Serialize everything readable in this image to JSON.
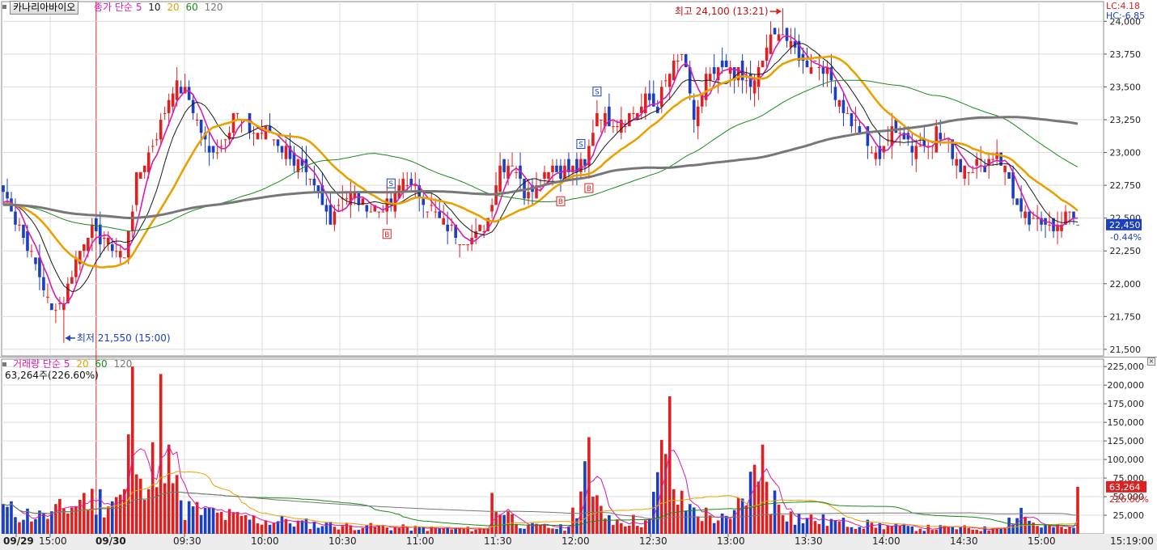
{
  "stock_name": "카나리아바이오",
  "price_legend": {
    "label": "종가 단순",
    "periods": [
      "5",
      "10",
      "20",
      "60",
      "120"
    ]
  },
  "volume_legend": {
    "label": "거래량 단순",
    "periods": [
      "5",
      "20",
      "60",
      "120"
    ]
  },
  "volume_info": "63,264주(226.60%)",
  "lc": "LC:4.18",
  "hc": "HC:-6.85",
  "current_price": "22,450",
  "current_change": "-0.44%",
  "current_volume": "63,264",
  "volume_ratio": "226.60%",
  "high_annotation": "최고 24,100 (13:21)",
  "low_annotation": "최저 21,550 (15:00)",
  "time_readout": "15:19:00",
  "colors": {
    "up": "#e02020",
    "down": "#1a3fc4",
    "ma5": "#d81bb0",
    "ma10": "#1a1a1a",
    "ma20": "#e8a200",
    "ma60": "#1a8a1a",
    "ma120": "#777777"
  },
  "chart_data": {
    "type": "candlestick",
    "price_axis": {
      "ticks": [
        21500,
        21750,
        22000,
        22250,
        22500,
        22750,
        23000,
        23250,
        23500,
        23750,
        24000
      ],
      "tick_labels": [
        "21,500",
        "21,750",
        "22,000",
        "22,250",
        "22,500",
        "22,750",
        "23,000",
        "23,250",
        "23,500",
        "23,750",
        "24,000"
      ],
      "range": [
        21450,
        24150
      ]
    },
    "volume_axis": {
      "ticks": [
        25000,
        50000,
        75000,
        100000,
        125000,
        150000,
        175000,
        200000,
        225000
      ],
      "tick_labels": [
        "25,000",
        "50,000",
        "75,000",
        "100,000",
        "125,000",
        "150,000",
        "175,000",
        "200,000",
        "225,000"
      ],
      "range": [
        0,
        235000
      ]
    },
    "time_axis": {
      "labels": [
        "09/29",
        "15:00",
        "09/30",
        "09:30",
        "10:00",
        "10:30",
        "11:00",
        "11:30",
        "12:00",
        "12:30",
        "13:00",
        "13:30",
        "14:00",
        "14:30",
        "15:00"
      ],
      "bold": [
        "09/29",
        "09/30"
      ]
    },
    "price_anchors": [
      [
        0,
        22720
      ],
      [
        3,
        22500
      ],
      [
        6,
        22300
      ],
      [
        9,
        22050
      ],
      [
        12,
        21800
      ],
      [
        15,
        21900
      ],
      [
        18,
        22200
      ],
      [
        21,
        22400
      ],
      [
        24,
        22350
      ],
      [
        27,
        22300
      ],
      [
        30,
        22200
      ],
      [
        33,
        22800
      ],
      [
        36,
        23000
      ],
      [
        39,
        23200
      ],
      [
        42,
        23500
      ],
      [
        45,
        23450
      ],
      [
        48,
        23250
      ],
      [
        51,
        23000
      ],
      [
        54,
        23050
      ],
      [
        57,
        23300
      ],
      [
        60,
        23200
      ],
      [
        63,
        23150
      ],
      [
        66,
        23150
      ],
      [
        69,
        23050
      ],
      [
        72,
        22950
      ],
      [
        75,
        22800
      ],
      [
        78,
        22650
      ],
      [
        81,
        22500
      ],
      [
        84,
        22700
      ],
      [
        87,
        22650
      ],
      [
        90,
        22600
      ],
      [
        93,
        22550
      ],
      [
        96,
        22620
      ],
      [
        99,
        22800
      ],
      [
        102,
        22700
      ],
      [
        105,
        22600
      ],
      [
        108,
        22500
      ],
      [
        111,
        22400
      ],
      [
        114,
        22350
      ],
      [
        117,
        22380
      ],
      [
        120,
        22500
      ],
      [
        123,
        22900
      ],
      [
        126,
        22950
      ],
      [
        129,
        22700
      ],
      [
        132,
        22750
      ],
      [
        135,
        22900
      ],
      [
        138,
        22850
      ],
      [
        141,
        22850
      ],
      [
        144,
        22900
      ],
      [
        147,
        23300
      ],
      [
        150,
        23250
      ],
      [
        153,
        23250
      ],
      [
        156,
        23300
      ],
      [
        159,
        23400
      ],
      [
        162,
        23350
      ],
      [
        165,
        23600
      ],
      [
        168,
        23750
      ],
      [
        171,
        23250
      ],
      [
        174,
        23550
      ],
      [
        177,
        23600
      ],
      [
        180,
        23650
      ],
      [
        183,
        23550
      ],
      [
        186,
        23500
      ],
      [
        189,
        23800
      ],
      [
        192,
        23950
      ],
      [
        195,
        23820
      ],
      [
        198,
        23700
      ],
      [
        201,
        23700
      ],
      [
        204,
        23600
      ],
      [
        207,
        23400
      ],
      [
        210,
        23250
      ],
      [
        213,
        23100
      ],
      [
        216,
        22950
      ],
      [
        219,
        23100
      ],
      [
        222,
        23200
      ],
      [
        225,
        23050
      ],
      [
        228,
        23050
      ],
      [
        231,
        23150
      ],
      [
        234,
        23050
      ],
      [
        237,
        22900
      ],
      [
        240,
        22900
      ],
      [
        243,
        22900
      ],
      [
        246,
        23000
      ],
      [
        249,
        22800
      ],
      [
        252,
        22500
      ],
      [
        255,
        22450
      ],
      [
        258,
        22500
      ],
      [
        261,
        22420
      ],
      [
        264,
        22550
      ],
      [
        266,
        22450
      ]
    ],
    "volume_anchors": [
      [
        0,
        40000
      ],
      [
        10,
        28000
      ],
      [
        20,
        55000
      ],
      [
        30,
        60000
      ],
      [
        32,
        225000
      ],
      [
        33,
        80000
      ],
      [
        36,
        60000
      ],
      [
        39,
        215000
      ],
      [
        41,
        120000
      ],
      [
        44,
        45000
      ],
      [
        50,
        35000
      ],
      [
        60,
        25000
      ],
      [
        70,
        20000
      ],
      [
        80,
        15000
      ],
      [
        90,
        12000
      ],
      [
        100,
        10000
      ],
      [
        110,
        8000
      ],
      [
        120,
        8000
      ],
      [
        121,
        55000
      ],
      [
        125,
        30000
      ],
      [
        130,
        12000
      ],
      [
        140,
        10000
      ],
      [
        145,
        130000
      ],
      [
        146,
        50000
      ],
      [
        150,
        25000
      ],
      [
        160,
        20000
      ],
      [
        165,
        185000
      ],
      [
        166,
        60000
      ],
      [
        170,
        40000
      ],
      [
        180,
        20000
      ],
      [
        188,
        120000
      ],
      [
        189,
        70000
      ],
      [
        195,
        30000
      ],
      [
        205,
        20000
      ],
      [
        215,
        15000
      ],
      [
        225,
        10000
      ],
      [
        235,
        10000
      ],
      [
        245,
        8000
      ],
      [
        252,
        35000
      ],
      [
        255,
        15000
      ],
      [
        265,
        8000
      ],
      [
        266,
        63264
      ]
    ],
    "session_break_index": 23
  }
}
